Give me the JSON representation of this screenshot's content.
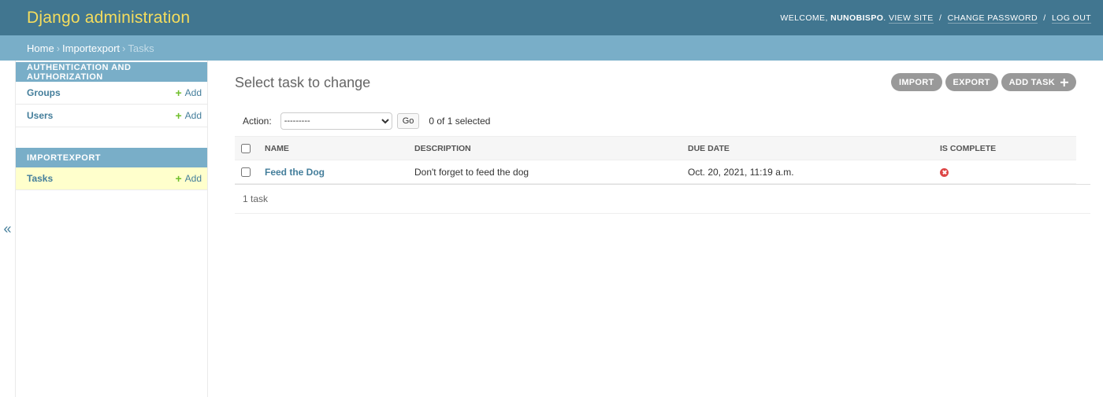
{
  "header": {
    "branding": "Django administration",
    "welcome": "WELCOME,",
    "username": "NUNOBISPO",
    "view_site": "VIEW SITE",
    "change_password": "CHANGE PASSWORD",
    "log_out": "LOG OUT",
    "separator": "/"
  },
  "breadcrumbs": {
    "home": "Home",
    "app": "Importexport",
    "current": "Tasks",
    "arrow": "›"
  },
  "sidebar": {
    "toggle": "«",
    "modules": [
      {
        "caption": "AUTHENTICATION AND AUTHORIZATION",
        "items": [
          {
            "label": "Groups",
            "add": "Add"
          },
          {
            "label": "Users",
            "add": "Add"
          }
        ]
      },
      {
        "caption": "IMPORTEXPORT",
        "items": [
          {
            "label": "Tasks",
            "add": "Add"
          }
        ]
      }
    ]
  },
  "content": {
    "title": "Select task to change",
    "tools": {
      "import": "IMPORT",
      "export": "EXPORT",
      "add": "ADD TASK"
    },
    "actions": {
      "label": "Action:",
      "selected_value": "---------",
      "go": "Go",
      "count": "0 of 1 selected"
    },
    "table": {
      "headers": [
        "NAME",
        "DESCRIPTION",
        "DUE DATE",
        "IS COMPLETE"
      ],
      "rows": [
        {
          "name": "Feed the Dog",
          "description": "Don't forget to feed the dog",
          "due_date": "Oct. 20, 2021, 11:19 a.m.",
          "is_complete": false
        }
      ]
    },
    "paginator": "1 task"
  },
  "colors": {
    "header_bg": "#417690",
    "branding": "#f5dd5d",
    "breadcrumbs_bg": "#79aec8",
    "link": "#447e9b",
    "add_green": "#70bf2b",
    "current_row": "#ffffcc",
    "no_icon": "#dd4646",
    "tool_button": "#999999"
  }
}
